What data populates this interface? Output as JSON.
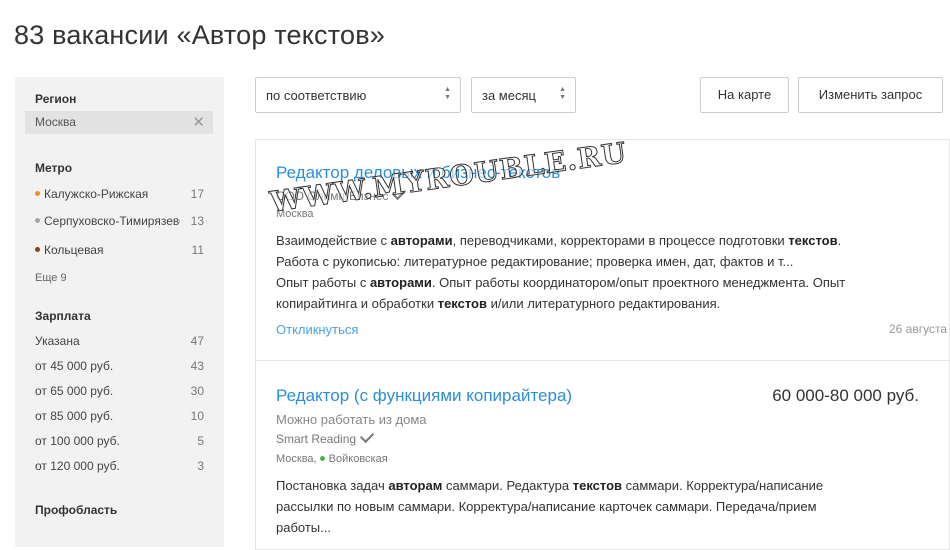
{
  "page": {
    "title": "83 вакансии «Автор текстов»"
  },
  "sidebar": {
    "region": {
      "heading": "Регион",
      "value": "Москва",
      "clear": "✕"
    },
    "metro": {
      "heading": "Метро",
      "items": [
        {
          "label": "Калужско-Рижская",
          "count": "17",
          "color": "#f28c28"
        },
        {
          "label": "Серпуховско-Тимирязевская",
          "count": "13",
          "color": "#a5a5a5"
        },
        {
          "label": "Кольцевая",
          "count": "11",
          "color": "#8b4513"
        }
      ],
      "more": "Еще 9"
    },
    "salary": {
      "heading": "Зарплата",
      "items": [
        {
          "label": "Указана",
          "count": "47"
        },
        {
          "label": "от 45 000 руб.",
          "count": "43"
        },
        {
          "label": "от 65 000 руб.",
          "count": "30"
        },
        {
          "label": "от 85 000 руб.",
          "count": "10"
        },
        {
          "label": "от 100 000 руб.",
          "count": "5"
        },
        {
          "label": "от 120 000 руб.",
          "count": "3"
        }
      ]
    },
    "profarea": {
      "heading": "Профобласть"
    }
  },
  "controls": {
    "sort": "по соответствию",
    "period": "за месяц",
    "map_button": "На карте",
    "change_button": "Изменить запрос"
  },
  "vacancies": [
    {
      "title": "Редактор деловых и бизнес-текстов",
      "company": "ООО Олимп-Бизнес",
      "location": "Москва",
      "text_l1_a": "Взаимодействие с ",
      "text_l1_b": "авторами",
      "text_l1_c": ", переводчиками, корректорами в процессе подготовки ",
      "text_l1_d": "текстов",
      "text_l1_e": ".",
      "text_l2": "Работа с рукописью: литературное редактирование; проверка имен, дат, фактов и т...",
      "text_l3_a": "Опыт работы с ",
      "text_l3_b": "авторами",
      "text_l3_c": ". Опыт работы координатором/опыт проектного менеджмента. Опыт",
      "text_l4_a": "копирайтинга и обработки ",
      "text_l4_b": "текстов",
      "text_l4_c": " и/или литературного редактирования.",
      "respond": "Откликнуться",
      "date": "26 августа"
    },
    {
      "title": "Редактор (с функциями копирайтера)",
      "salary": "60 000-80 000 руб.",
      "remote": "Можно работать из дома",
      "company": "Smart Reading",
      "location": "Москва, ",
      "metro": "Войковская",
      "metro_color": "#4caf50",
      "text_l1_a": "Постановка задач ",
      "text_l1_b": "авторам",
      "text_l1_c": " саммари. Редактура ",
      "text_l1_d": "текстов",
      "text_l1_e": " саммари. Корректура/написание",
      "text_l2": "рассылки по новым саммари. Корректура/написание карточек саммари. Передача/прием",
      "text_l3": "работы..."
    }
  ],
  "watermark": "WWW.MYROUBLE.RU"
}
